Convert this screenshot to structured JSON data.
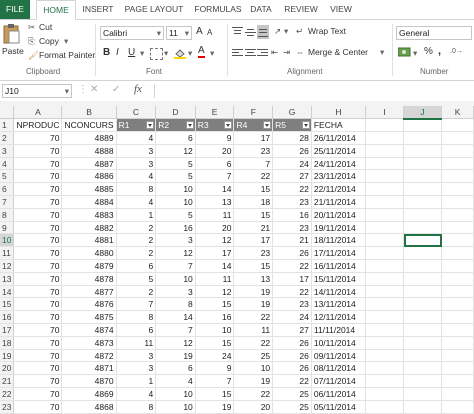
{
  "tabs": [
    "FILE",
    "HOME",
    "INSERT",
    "PAGE LAYOUT",
    "FORMULAS",
    "DATA",
    "REVIEW",
    "VIEW"
  ],
  "clipboard": {
    "paste": "Paste",
    "cut": "Cut",
    "copy": "Copy",
    "copy_arrow": "▾",
    "format_painter": "Format Painter",
    "group": "Clipboard"
  },
  "font": {
    "name": "Calibri",
    "size": "11",
    "grow": "A",
    "shrink": "A",
    "bold": "B",
    "italic": "I",
    "underline": "U",
    "font_color": "A",
    "group": "Font"
  },
  "alignment": {
    "wrap_text": "Wrap Text",
    "merge_center": "Merge & Center",
    "group": "Alignment"
  },
  "number": {
    "format": "General",
    "group": "Number",
    "percent": "%",
    "comma": ","
  },
  "namebox": "J10",
  "formula_icons": {
    "cancel": "✕",
    "enter": "✓",
    "fx": "fx"
  },
  "columns": [
    "A",
    "B",
    "C",
    "D",
    "E",
    "F",
    "G",
    "H",
    "I",
    "J",
    "K"
  ],
  "header_row": [
    "NPRODUC",
    "NCONCURS",
    "R1",
    "R2",
    "R3",
    "R4",
    "R5",
    "FECHA"
  ],
  "rows": [
    [
      "70",
      "4889",
      "4",
      "6",
      "9",
      "17",
      "28",
      "26/11/2014"
    ],
    [
      "70",
      "4888",
      "3",
      "12",
      "20",
      "23",
      "26",
      "25/11/2014"
    ],
    [
      "70",
      "4887",
      "3",
      "5",
      "6",
      "7",
      "24",
      "24/11/2014"
    ],
    [
      "70",
      "4886",
      "4",
      "5",
      "7",
      "22",
      "27",
      "23/11/2014"
    ],
    [
      "70",
      "4885",
      "8",
      "10",
      "14",
      "15",
      "22",
      "22/11/2014"
    ],
    [
      "70",
      "4884",
      "4",
      "10",
      "13",
      "18",
      "23",
      "21/11/2014"
    ],
    [
      "70",
      "4883",
      "1",
      "5",
      "11",
      "15",
      "16",
      "20/11/2014"
    ],
    [
      "70",
      "4882",
      "2",
      "16",
      "20",
      "21",
      "23",
      "19/11/2014"
    ],
    [
      "70",
      "4881",
      "2",
      "3",
      "12",
      "17",
      "21",
      "18/11/2014"
    ],
    [
      "70",
      "4880",
      "2",
      "12",
      "17",
      "23",
      "26",
      "17/11/2014"
    ],
    [
      "70",
      "4879",
      "6",
      "7",
      "14",
      "15",
      "22",
      "16/11/2014"
    ],
    [
      "70",
      "4878",
      "5",
      "10",
      "11",
      "13",
      "17",
      "15/11/2014"
    ],
    [
      "70",
      "4877",
      "2",
      "3",
      "12",
      "19",
      "22",
      "14/11/2014"
    ],
    [
      "70",
      "4876",
      "7",
      "8",
      "15",
      "19",
      "23",
      "13/11/2014"
    ],
    [
      "70",
      "4875",
      "8",
      "14",
      "16",
      "22",
      "24",
      "12/11/2014"
    ],
    [
      "70",
      "4874",
      "6",
      "7",
      "10",
      "11",
      "27",
      "11/11/2014"
    ],
    [
      "70",
      "4873",
      "11",
      "12",
      "15",
      "22",
      "26",
      "10/11/2014"
    ],
    [
      "70",
      "4872",
      "3",
      "19",
      "24",
      "25",
      "26",
      "09/11/2014"
    ],
    [
      "70",
      "4871",
      "3",
      "6",
      "9",
      "10",
      "26",
      "08/11/2014"
    ],
    [
      "70",
      "4870",
      "1",
      "4",
      "7",
      "19",
      "22",
      "07/11/2014"
    ],
    [
      "70",
      "4869",
      "4",
      "10",
      "15",
      "22",
      "25",
      "06/11/2014"
    ],
    [
      "70",
      "4868",
      "8",
      "10",
      "19",
      "20",
      "25",
      "05/11/2014"
    ]
  ],
  "row_numbers": [
    "1",
    "2",
    "3",
    "4",
    "5",
    "6",
    "7",
    "8",
    "9",
    "10",
    "11",
    "12",
    "13",
    "14",
    "15",
    "16",
    "17",
    "18",
    "19",
    "20",
    "21",
    "22",
    "23"
  ]
}
